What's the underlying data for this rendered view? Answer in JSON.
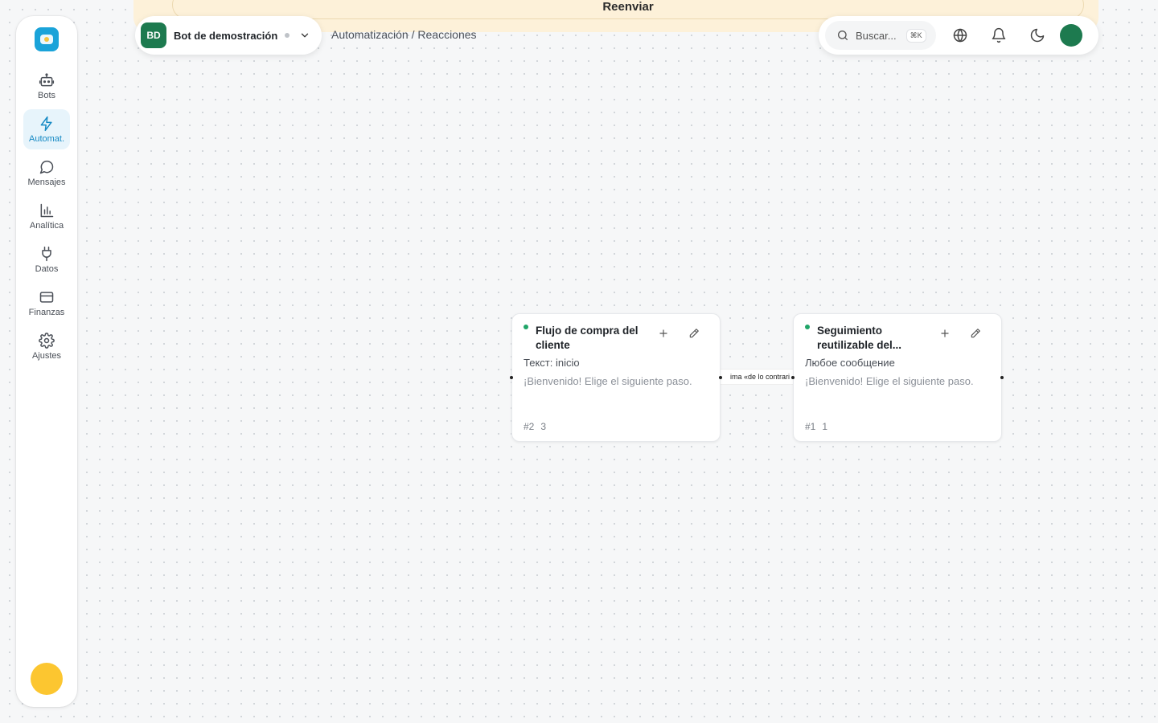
{
  "banner": {
    "label": "Reenviar"
  },
  "sidebar": {
    "items": [
      {
        "label": "Bots",
        "icon": "robot-icon"
      },
      {
        "label": "Automat.",
        "icon": "lightning-icon",
        "active": true
      },
      {
        "label": "Mensajes",
        "icon": "chat-bubble-icon"
      },
      {
        "label": "Analítica",
        "icon": "bar-chart-icon"
      },
      {
        "label": "Datos",
        "icon": "plug-icon"
      },
      {
        "label": "Finanzas",
        "icon": "credit-card-icon"
      },
      {
        "label": "Ajustes",
        "icon": "gear-icon"
      }
    ]
  },
  "bot_selector": {
    "initials": "BD",
    "name": "Bot de demostración"
  },
  "breadcrumb": "Automatización / Reacciones",
  "toolbar": {
    "search_placeholder": "Buscar...",
    "shortcut": "⌘K"
  },
  "nodes": [
    {
      "title": "Flujo de compra del cliente",
      "trigger": "Текст: inicio",
      "message": "¡Bienvenido! Elige el siguiente paso.",
      "id_label": "#2",
      "count": "3"
    },
    {
      "title": "Seguimiento reutilizable del...",
      "trigger": "Любое сообщение",
      "message": "¡Bienvenido! Elige el siguiente paso.",
      "id_label": "#1",
      "count": "1"
    }
  ],
  "edge": {
    "label": "ima «de lo contrari"
  },
  "colors": {
    "accent": "#1589c4",
    "bot_badge": "#1d7a4f",
    "banner": "#fdf1d9",
    "node_status": "#20a568",
    "user_avatar_sidebar": "#fcc630"
  }
}
